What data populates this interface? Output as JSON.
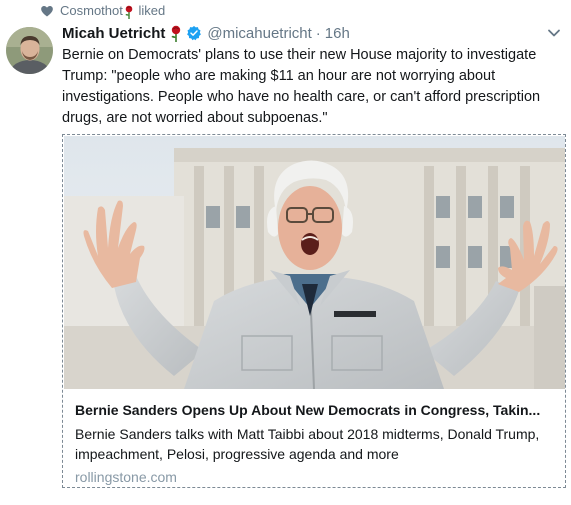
{
  "social_context": {
    "liker": "Cosmothot",
    "action": "liked",
    "icon": "heart-icon"
  },
  "tweet": {
    "author_name": "Micah Uetricht",
    "handle": "@micahuetricht",
    "separator": "·",
    "timestamp": "16h",
    "verified": true,
    "text": "Bernie on Democrats' plans to use their new House majority to investigate\nTrump: \"people who are making $11 an hour are not worrying about\ninvestigations. People who have no health care, or can't afford prescription\ndrugs, are not worried about subpoenas.\""
  },
  "card": {
    "title": "Bernie Sanders Opens Up About New Democrats in Congress, Takin...",
    "description": "Bernie Sanders talks with Matt Taibbi about 2018 midterms, Donald Trump,\nimpeachment, Pelosi, progressive agenda and more",
    "domain": "rollingstone.com"
  },
  "colors": {
    "muted": "#657786",
    "verified": "#1da1f2",
    "rose": "#c1121f"
  }
}
